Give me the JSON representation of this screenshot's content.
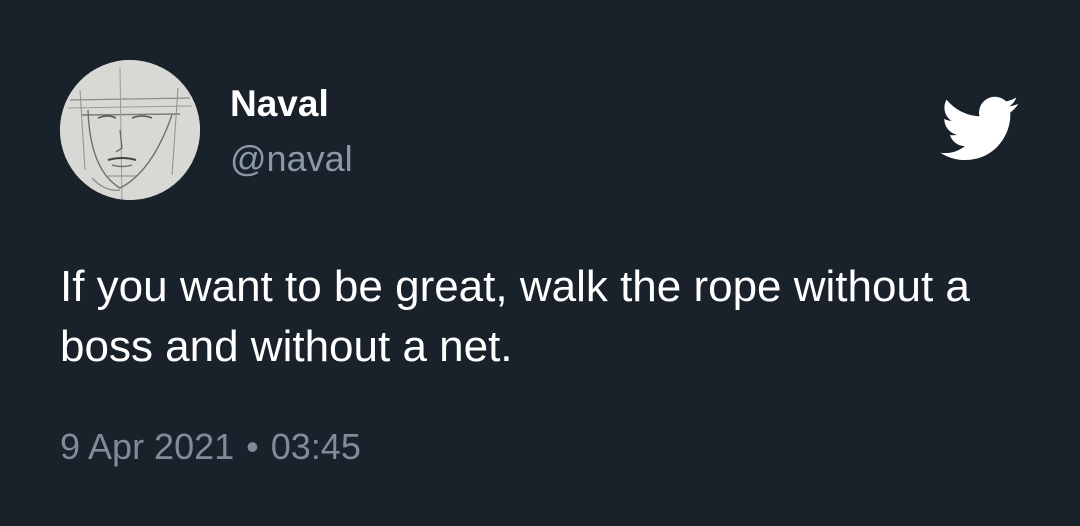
{
  "author": {
    "name": "Naval",
    "handle": "@naval"
  },
  "tweet": {
    "text": "If you want to be great, walk the rope without a boss and without a net.",
    "date": "9 Apr 2021",
    "separator": "•",
    "time": "03:45"
  },
  "icons": {
    "brand": "twitter-bird-icon",
    "avatar": "sketch-face-avatar"
  },
  "colors": {
    "background": "#19212b",
    "text": "#ffffff",
    "secondary_text": "#8b98a5",
    "meta_text": "#7f8b96"
  }
}
